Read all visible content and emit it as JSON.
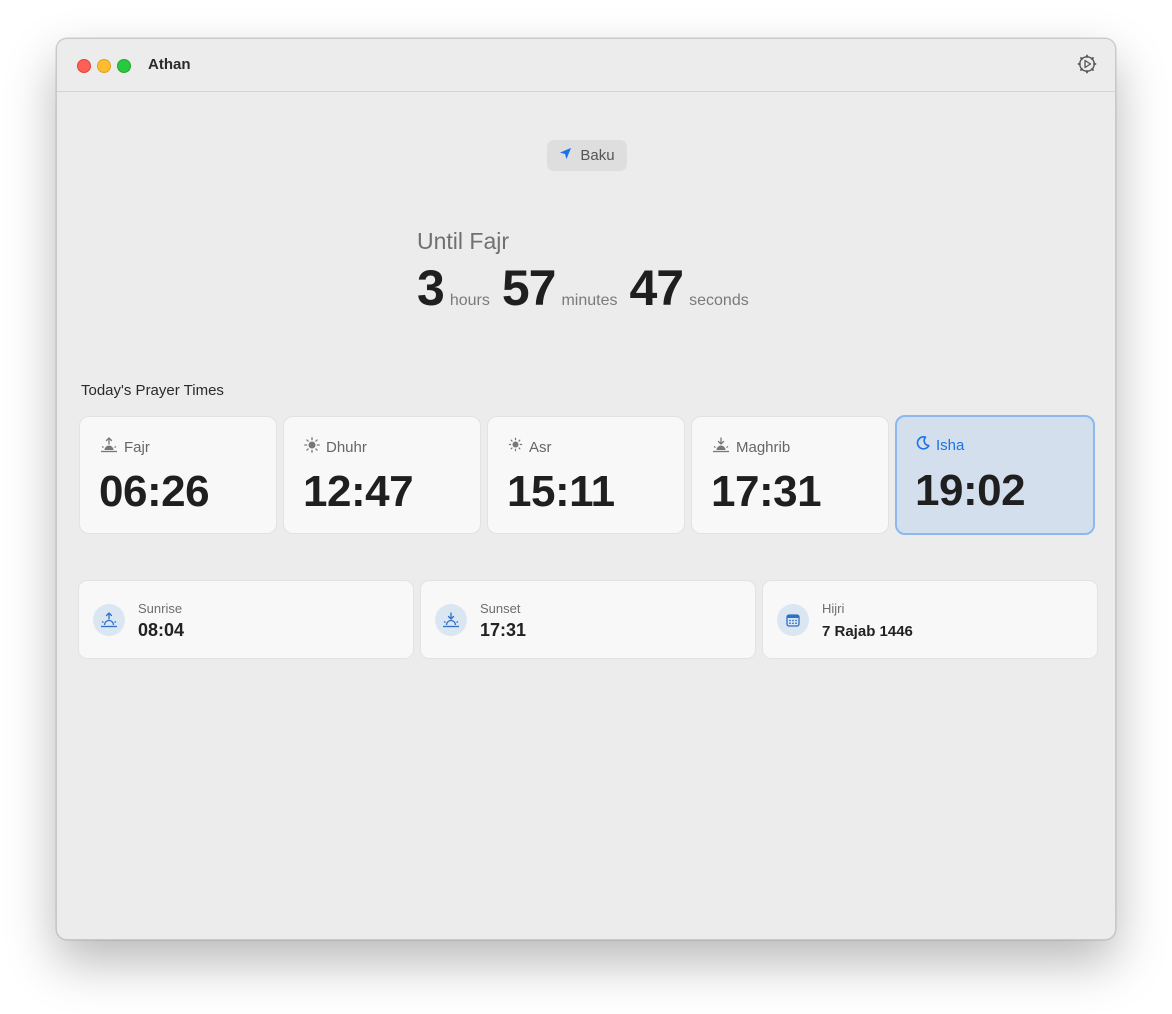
{
  "window": {
    "title": "Athan"
  },
  "location": {
    "city": "Baku",
    "icon": "location-arrow-icon"
  },
  "countdown": {
    "title": "Until Fajr",
    "hours": "3",
    "hours_unit": "hours",
    "minutes": "57",
    "minutes_unit": "minutes",
    "seconds": "47",
    "seconds_unit": "seconds"
  },
  "prayers": {
    "section_title": "Today's Prayer Times",
    "items": [
      {
        "name": "Fajr",
        "time": "06:26",
        "icon": "sunrise-icon"
      },
      {
        "name": "Dhuhr",
        "time": "12:47",
        "icon": "sun-icon"
      },
      {
        "name": "Asr",
        "time": "15:11",
        "icon": "sun-small-icon"
      },
      {
        "name": "Maghrib",
        "time": "17:31",
        "icon": "sunset-icon"
      },
      {
        "name": "Isha",
        "time": "19:02",
        "icon": "moon-icon",
        "active": true
      }
    ]
  },
  "info": {
    "items": [
      {
        "label": "Sunrise",
        "value": "08:04",
        "icon": "sunrise-icon"
      },
      {
        "label": "Sunset",
        "value": "17:31",
        "icon": "sunset-icon"
      },
      {
        "label": "Hijri",
        "value": "7 Rajab 1446",
        "icon": "calendar-icon"
      }
    ]
  },
  "colors": {
    "accent": "#1a73e8",
    "active_card_bg": "#d4dfee",
    "active_card_border": "#8bb8ee"
  }
}
